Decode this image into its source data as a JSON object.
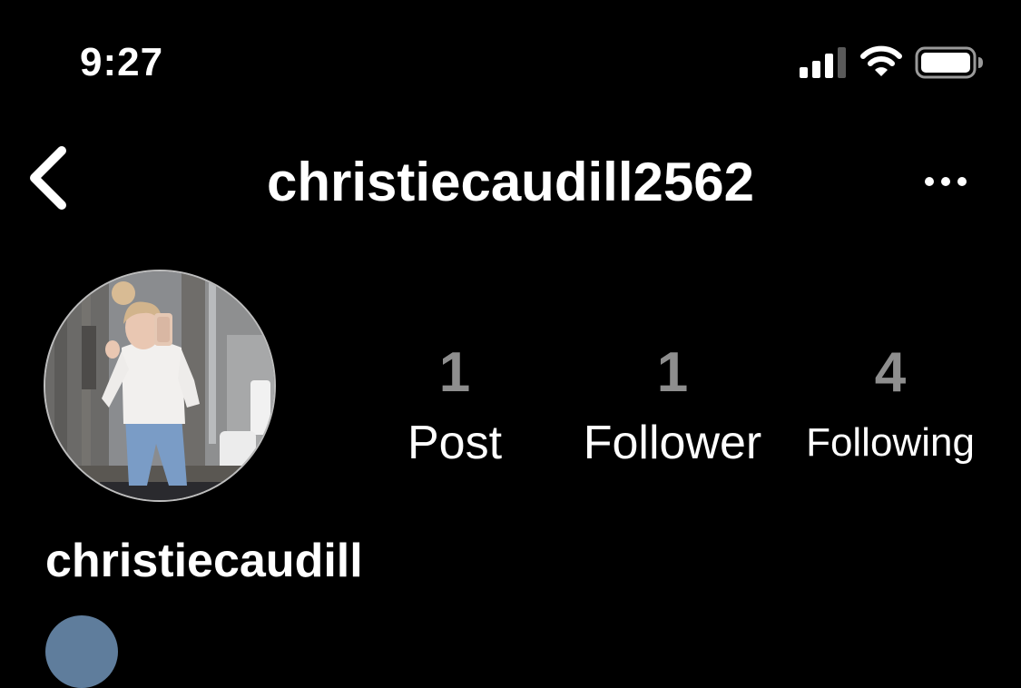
{
  "status_bar": {
    "time": "9:27"
  },
  "header": {
    "username": "christiecaudill2562"
  },
  "profile": {
    "display_name": "christiecaudill"
  },
  "stats": [
    {
      "count": "1",
      "label": "Post"
    },
    {
      "count": "1",
      "label": "Follower"
    },
    {
      "count": "4",
      "label": "Following"
    }
  ],
  "icons": {
    "back": "chevron-left-icon",
    "more": "more-horizontal-icon",
    "signal": "cellular-signal-icon",
    "wifi": "wifi-icon",
    "battery": "battery-icon"
  },
  "colors": {
    "background": "#000000",
    "text": "#ffffff",
    "count": "#8e8e8e"
  }
}
